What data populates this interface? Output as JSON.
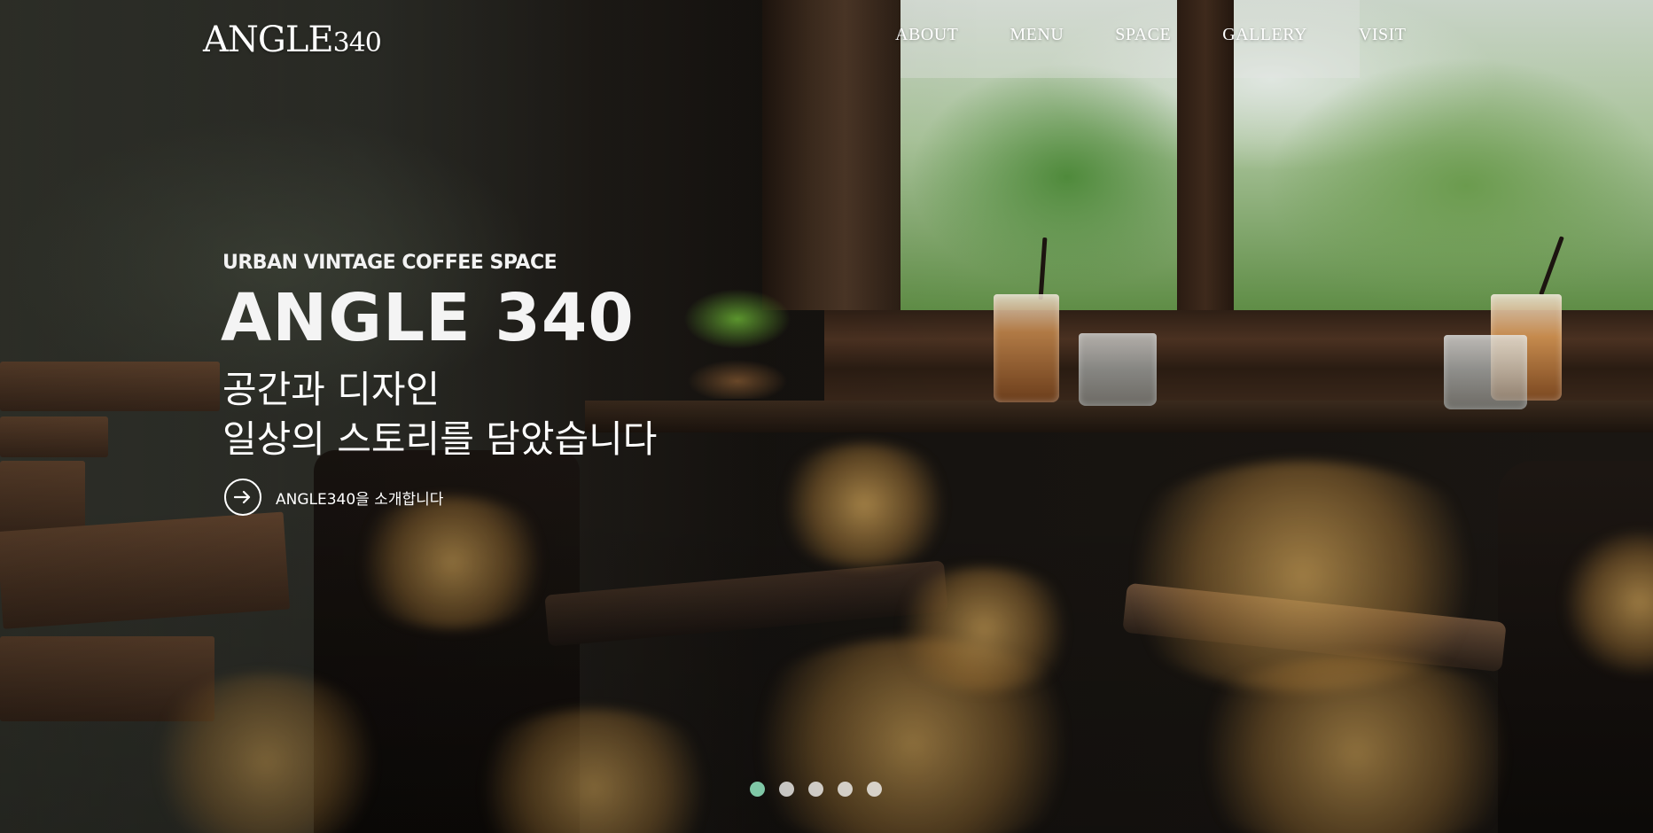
{
  "brand": {
    "logo_text": "ANGLE",
    "logo_number": "340"
  },
  "nav": {
    "items": [
      {
        "label": "ABOUT"
      },
      {
        "label": "MENU"
      },
      {
        "label": "SPACE"
      },
      {
        "label": "GALLERY"
      },
      {
        "label": "VISIT"
      }
    ]
  },
  "hero": {
    "tagline": "URBAN VINTAGE COFFEE SPACE",
    "headline": "ANGLE 340",
    "subcopy_line1": "공간과 디자인",
    "subcopy_line2": "일상의 스토리를 담았습니다",
    "cta_label": "ANGLE340을 소개합니다",
    "cta_icon": "arrow-right-icon"
  },
  "slider": {
    "total_slides": 5,
    "active_slide": 1,
    "active_color": "#7fc7a6"
  }
}
